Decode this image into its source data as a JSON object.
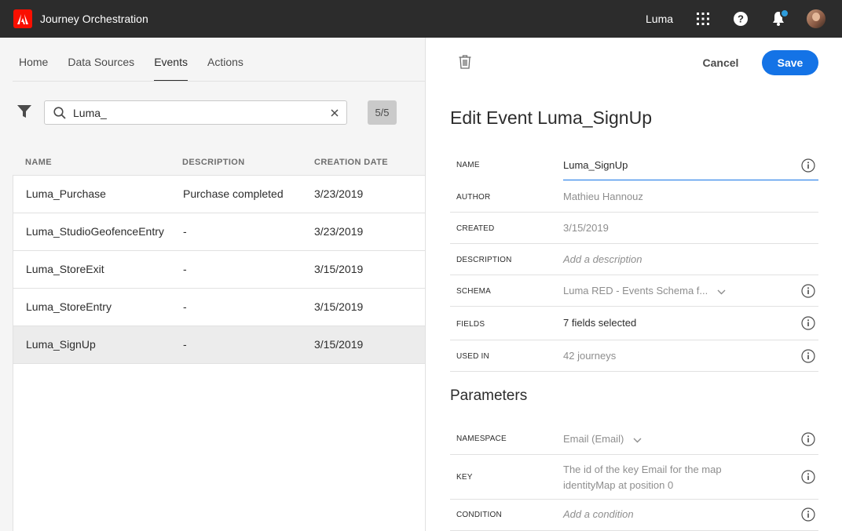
{
  "topbar": {
    "app_title": "Journey Orchestration",
    "org_name": "Luma",
    "notification_dot_color": "#2d9cdb"
  },
  "nav": {
    "tabs": [
      {
        "label": "Home",
        "active": false
      },
      {
        "label": "Data Sources",
        "active": false
      },
      {
        "label": "Events",
        "active": true
      },
      {
        "label": "Actions",
        "active": false
      }
    ]
  },
  "search": {
    "value": "Luma_",
    "count": "5/5"
  },
  "table": {
    "headers": [
      "NAME",
      "DESCRIPTION",
      "CREATION DATE"
    ],
    "rows": [
      {
        "name": "Luma_Purchase",
        "description": "Purchase completed",
        "date": "3/23/2019",
        "selected": false
      },
      {
        "name": "Luma_StudioGeofenceEntry",
        "description": "-",
        "date": "3/23/2019",
        "selected": false
      },
      {
        "name": "Luma_StoreExit",
        "description": "-",
        "date": "3/15/2019",
        "selected": false
      },
      {
        "name": "Luma_StoreEntry",
        "description": "-",
        "date": "3/15/2019",
        "selected": false
      },
      {
        "name": "Luma_SignUp",
        "description": "-",
        "date": "3/15/2019",
        "selected": true
      }
    ]
  },
  "panel": {
    "cancel_label": "Cancel",
    "save_label": "Save",
    "title": "Edit Event Luma_SignUp",
    "fields": {
      "name": {
        "label": "NAME",
        "value": "Luma_SignUp"
      },
      "author": {
        "label": "AUTHOR",
        "value": "Mathieu Hannouz"
      },
      "created": {
        "label": "CREATED",
        "value": "3/15/2019"
      },
      "description": {
        "label": "DESCRIPTION",
        "placeholder": "Add a description"
      },
      "schema": {
        "label": "SCHEMA",
        "value": "Luma RED - Events Schema f..."
      },
      "fields": {
        "label": "FIELDS",
        "value": "7 fields selected"
      },
      "used_in": {
        "label": "USED IN",
        "value": "42 journeys"
      }
    },
    "parameters_title": "Parameters",
    "parameters": {
      "namespace": {
        "label": "NAMESPACE",
        "value": "Email (Email)"
      },
      "key": {
        "label": "KEY",
        "line1": "The id of the key Email for the map",
        "line2": "identityMap at position 0"
      },
      "condition": {
        "label": "CONDITION",
        "placeholder": "Add a condition"
      }
    }
  },
  "colors": {
    "accent": "#1473e6",
    "adobe_red": "#fa0f00",
    "topbar": "#2c2c2c"
  }
}
